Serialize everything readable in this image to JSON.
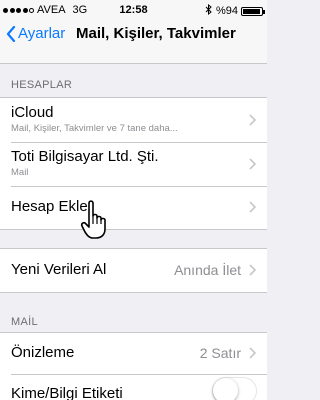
{
  "status_bar": {
    "carrier": "AVEA",
    "network": "3G",
    "time": "12:58",
    "battery_percent": "%94",
    "battery_level": 0.94,
    "signal_bars": 4,
    "icons": [
      "signal-dots-icon",
      "bluetooth-icon",
      "battery-icon"
    ]
  },
  "nav": {
    "back_label": "Ayarlar",
    "title": "Mail, Kişiler, Takvimler"
  },
  "accounts": {
    "header": "HESAPLAR",
    "items": [
      {
        "title": "iCloud",
        "subtitle": "Mail, Kişiler, Takvimler ve 7 tane daha..."
      },
      {
        "title": "Toti Bilgisayar Ltd. Şti.",
        "subtitle": "Mail"
      },
      {
        "title": "Hesap Ekle"
      }
    ]
  },
  "fetch": {
    "title": "Yeni Verileri Al",
    "value": "Anında İlet"
  },
  "mail": {
    "header": "MAİL",
    "preview_title": "Önizleme",
    "preview_value": "2 Satır",
    "tocc_title": "Kime/Bilgi Etiketi",
    "tocc_on": false
  },
  "colors": {
    "accent": "#0a7aff",
    "background": "#efeff4",
    "separator": "#c8c7cc",
    "secondary_text": "#8e8e93"
  }
}
